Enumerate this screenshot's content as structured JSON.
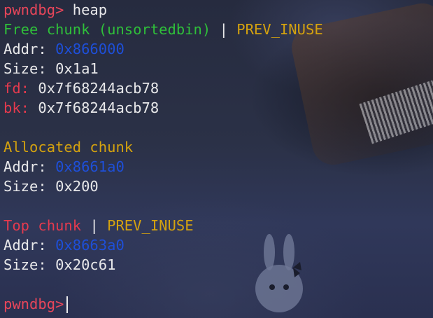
{
  "prompt": "pwndbg>",
  "command": "heap",
  "free_chunk": {
    "header": "Free chunk (unsortedbin)",
    "separator": "|",
    "flag": "PREV_INUSE",
    "addr_label": "Addr:",
    "addr": "0x866000",
    "size_label": "Size:",
    "size": "0x1a1",
    "fd_label": "fd:",
    "fd": "0x7f68244acb78",
    "bk_label": "bk:",
    "bk": "0x7f68244acb78"
  },
  "allocated_chunk": {
    "header": "Allocated chunk",
    "addr_label": "Addr:",
    "addr": "0x8661a0",
    "size_label": "Size:",
    "size": "0x200"
  },
  "top_chunk": {
    "header": "Top chunk",
    "separator": "|",
    "flag": "PREV_INUSE",
    "addr_label": "Addr:",
    "addr": "0x8663a0",
    "size_label": "Size:",
    "size": "0x20c61"
  },
  "colors": {
    "prompt": "#e8465a",
    "free_header": "#2fbf3a",
    "flag": "#d4a20f",
    "top_header": "#e53a4e",
    "address": "#1e4fd8",
    "text": "#e8e8ea"
  }
}
